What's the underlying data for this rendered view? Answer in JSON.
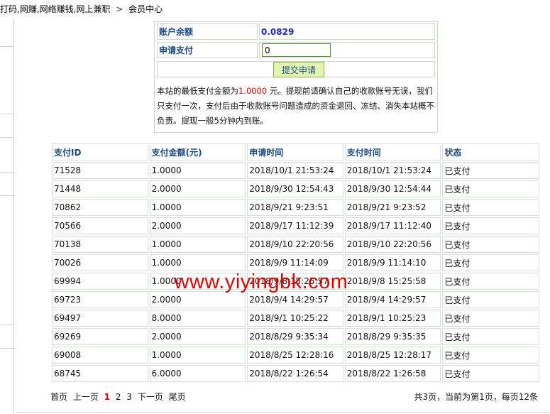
{
  "breadcrumb": {
    "site": "打码,网赚,网络赚钱,网上兼职",
    "separator": ">",
    "current": "会员中心"
  },
  "form": {
    "balance_label": "账户余额",
    "balance_value": "0.0829",
    "apply_label": "申请支付",
    "amount_value": "0",
    "submit_label": "提交申请",
    "notice_part1": "本站的最低支付金额为",
    "notice_min_amount": "1.0000",
    "notice_part2": " 元。提现前请确认自己的收款账号无误，我们只支付一次，支付后由于收款账号问题造成的资金退回、冻结、消失本站概不负责。提现一般5分钟内到账。"
  },
  "table": {
    "headers": [
      "支付ID",
      "支付金额(元)",
      "申请时间",
      "支付时间",
      "状态"
    ],
    "rows": [
      [
        "71528",
        "1.0000",
        "2018/10/1 21:53:24",
        "2018/10/1 21:53:24",
        "已支付"
      ],
      [
        "71448",
        "2.0000",
        "2018/9/30 12:54:43",
        "2018/9/30 12:54:44",
        "已支付"
      ],
      [
        "70862",
        "1.0000",
        "2018/9/21 9:23:51",
        "2018/9/21 9:23:52",
        "已支付"
      ],
      [
        "70566",
        "2.0000",
        "2018/9/17 11:12:39",
        "2018/9/17 11:12:40",
        "已支付"
      ],
      [
        "70138",
        "1.0000",
        "2018/9/10 22:20:56",
        "2018/9/10 22:20:56",
        "已支付"
      ],
      [
        "70026",
        "1.0000",
        "2018/9/9 11:14:09",
        "2018/9/9 11:14:10",
        "已支付"
      ],
      [
        "69994",
        "1.0000",
        "2018/9/8 15:25:57",
        "2018/9/8 15:25:58",
        "已支付"
      ],
      [
        "69723",
        "2.0000",
        "2018/9/4 14:29:57",
        "2018/9/4 14:29:57",
        "已支付"
      ],
      [
        "69497",
        "8.0000",
        "2018/9/1 10:25:22",
        "2018/9/1 10:25:23",
        "已支付"
      ],
      [
        "69269",
        "2.0000",
        "2018/8/29 9:35:34",
        "2018/8/29 9:35:35",
        "已支付"
      ],
      [
        "69008",
        "1.0000",
        "2018/8/25 12:28:16",
        "2018/8/25 12:28:17",
        "已支付"
      ],
      [
        "68745",
        "6.0000",
        "2018/8/22 1:26:54",
        "2018/8/22 1:26:58",
        "已支付"
      ]
    ]
  },
  "pager": {
    "first": "首页",
    "prev": "上一页",
    "pages": [
      "1",
      "2",
      "3"
    ],
    "current_page": "1",
    "next": "下一页",
    "last": "尾页",
    "summary": "共3页，当前为第1页，每页12条"
  },
  "watermark": "www.yiyingbk.com",
  "colors": {
    "label_blue": "#1a4a85",
    "balance_blue": "#1a2ccc",
    "accent_red": "#e00000",
    "button_bg": "#e3f6b0",
    "border_green": "#c9d9c9"
  }
}
